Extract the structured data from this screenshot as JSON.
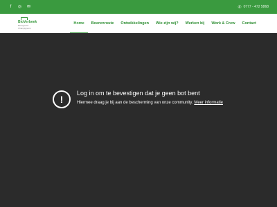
{
  "topbar": {
    "social": [
      "facebook-icon",
      "instagram-icon",
      "email-icon"
    ],
    "phone": "0777 - 472 5868"
  },
  "header": {
    "logo": {
      "name": "BioVerbeek",
      "tagline": "Biologische Champignons"
    },
    "menu": [
      {
        "label": "Home",
        "active": true
      },
      {
        "label": "Boerenroute",
        "active": false
      },
      {
        "label": "Ontwikkelingen",
        "active": false
      },
      {
        "label": "Wie zijn wij?",
        "active": false
      },
      {
        "label": "Werken bij",
        "active": false
      },
      {
        "label": "Work & Crew",
        "active": false
      },
      {
        "label": "Contact",
        "active": false
      }
    ]
  },
  "bot_check": {
    "icon": "exclamation-icon",
    "title": "Log in om te bevestigen dat je geen bot bent",
    "text": "Hiermee draag je bij aan de bescherming van onze community.",
    "link": "Meer informatie"
  },
  "colors": {
    "brand_green": "#3a9a3f",
    "overlay": "#2b2b2b"
  }
}
